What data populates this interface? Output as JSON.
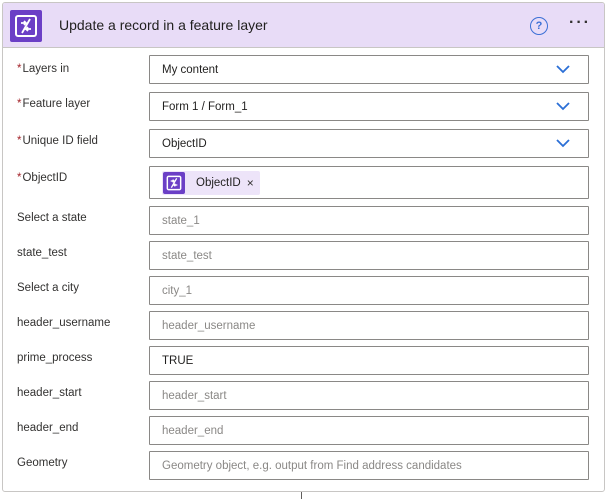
{
  "header": {
    "title": "Update a record in a feature layer",
    "help_label": "?",
    "more_label": "···",
    "accent": "#6b3fc6",
    "background": "#e8dcf7"
  },
  "fields": {
    "layers_in": {
      "label": "Layers in",
      "required": "*",
      "value": "My content"
    },
    "feature_layer": {
      "label": "Feature layer",
      "required": "*",
      "value": "Form 1 / Form_1"
    },
    "unique_id_field": {
      "label": "Unique ID field",
      "required": "*",
      "value": "ObjectID"
    },
    "object_id": {
      "label": "ObjectID",
      "required": "*",
      "token": "ObjectID",
      "token_remove": "×"
    },
    "select_state": {
      "label": "Select a state",
      "placeholder": "state_1"
    },
    "state_test": {
      "label": "state_test",
      "placeholder": "state_test"
    },
    "select_city": {
      "label": "Select a city",
      "placeholder": "city_1"
    },
    "header_username": {
      "label": "header_username",
      "placeholder": "header_username"
    },
    "prime_process": {
      "label": "prime_process",
      "value": "TRUE"
    },
    "header_start": {
      "label": "header_start",
      "placeholder": "header_start"
    },
    "header_end": {
      "label": "header_end",
      "placeholder": "header_end"
    },
    "geometry": {
      "label": "Geometry",
      "placeholder": "Geometry object, e.g. output from Find address candidates"
    }
  }
}
